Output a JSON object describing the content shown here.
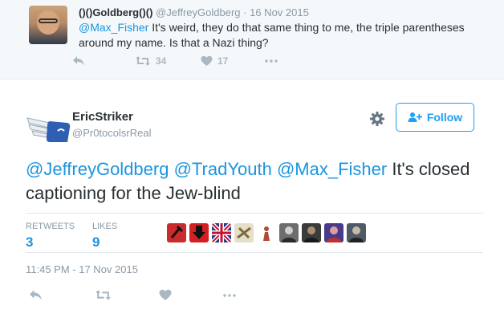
{
  "parent_tweet": {
    "name": "((()))Goldberg((()))",
    "name_display": "()()Goldberg()()",
    "handle": "@JeffreyGoldberg",
    "separator": "·",
    "date": "16 Nov 2015",
    "mention": "@Max_Fisher",
    "text": " It's weird, they do that same thing to me, the triple parentheses around my name. Is that a Nazi thing?",
    "retweets": "34",
    "likes": "17"
  },
  "main_tweet": {
    "name": "EricStriker",
    "handle": "@Pr0tocolsrReal",
    "follow_label": "Follow",
    "mentions": [
      "@JeffreyGoldberg",
      "@TradYouth",
      "@Max_Fisher"
    ],
    "text": " It's closed captioning for the Jew-blind",
    "timestamp": "11:45 PM - 17 Nov 2015"
  },
  "stats": {
    "retweets_label": "RETWEETS",
    "retweets_value": "3",
    "likes_label": "LIKES",
    "likes_value": "9",
    "liker_avatar_count": 9
  },
  "icons": {
    "reply": "reply-icon",
    "retweet": "retweet-icon",
    "like": "heart-icon",
    "more": "more-icon",
    "settings": "gear-icon",
    "follow": "add-user-icon"
  },
  "colors": {
    "link": "#1b95e0",
    "brand": "#1da1f2",
    "muted": "#8899a6",
    "icon": "#aab8c2"
  }
}
